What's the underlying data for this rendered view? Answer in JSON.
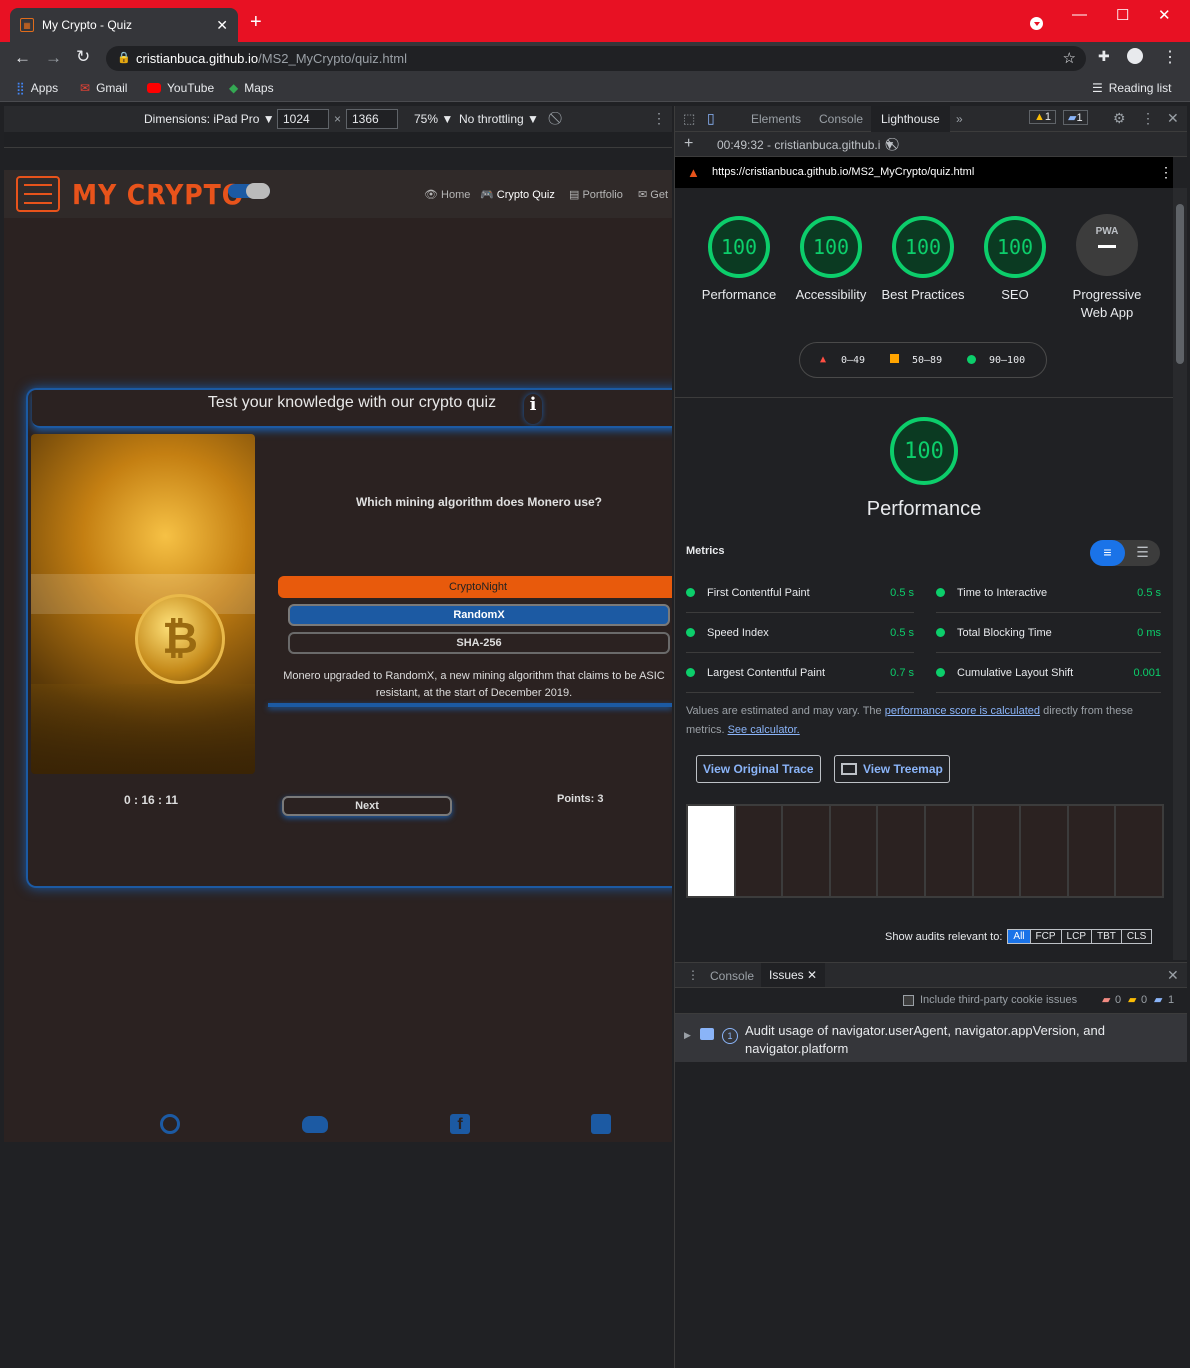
{
  "browser": {
    "tab_title": "My Crypto - Quiz",
    "new_tab": "+",
    "url_host": "cristianbuca.github.io",
    "url_path": "/MS2_MyCrypto/quiz.html",
    "bookmarks": [
      "Apps",
      "Gmail",
      "YouTube",
      "Maps"
    ],
    "reading_list": "Reading list"
  },
  "device_toolbar": {
    "dimensions_label": "Dimensions: iPad Pro ▼",
    "width": "1024",
    "times": "×",
    "height": "1366",
    "zoom": "75% ▼",
    "throttling": "No throttling ▼"
  },
  "site": {
    "logo": "MY CRYPTO",
    "nav": [
      "Home",
      "Crypto Quiz",
      "Portfolio",
      "Get"
    ],
    "quiz_title": "Test your knowledge with our crypto quiz",
    "info_icon_text": "i",
    "question": "Which mining algorithm does Monero use?",
    "options": [
      "CryptoNight",
      "RandomX",
      "SHA-256"
    ],
    "explanation": "Monero upgraded to RandomX, a new mining algorithm that claims to be ASIC resistant, at the start of December 2019.",
    "timer": "0 : 16 : 11",
    "next_label": "Next",
    "points": "Points: 3"
  },
  "devtools": {
    "tabs": [
      "Elements",
      "Console",
      "Lighthouse",
      "»"
    ],
    "warn_count": "1",
    "info_count": "1",
    "report_select": "00:49:32 - cristianbuca.github.i ▼",
    "report_url": "https://cristianbuca.github.io/MS2_MyCrypto/quiz.html",
    "categories": [
      {
        "label": "Performance",
        "score": "100"
      },
      {
        "label": "Accessibility",
        "score": "100"
      },
      {
        "label": "Best Practices",
        "score": "100"
      },
      {
        "label": "SEO",
        "score": "100"
      },
      {
        "label": "Progressive Web App",
        "score": "PWA"
      }
    ],
    "legend": [
      "0–49",
      "50–89",
      "90–100"
    ],
    "perf_score": "100",
    "perf_title": "Performance",
    "metrics_heading": "Metrics",
    "metrics": [
      {
        "name": "First Contentful Paint",
        "value": "0.5 s"
      },
      {
        "name": "Time to Interactive",
        "value": "0.5 s"
      },
      {
        "name": "Speed Index",
        "value": "0.5 s"
      },
      {
        "name": "Total Blocking Time",
        "value": "0 ms"
      },
      {
        "name": "Largest Contentful Paint",
        "value": "0.7 s"
      },
      {
        "name": "Cumulative Layout Shift",
        "value": "0.001"
      }
    ],
    "note_pre": "Values are estimated and may vary. The ",
    "note_link": "performance score is calculated",
    "note_post": " directly from these metrics. ",
    "note_link2": "See calculator.",
    "view_trace": "View Original Trace",
    "view_treemap": "View Treemap",
    "show_audits": "Show audits relevant to:",
    "filters": [
      "All",
      "FCP",
      "LCP",
      "TBT",
      "CLS"
    ],
    "drawer_tabs": [
      "Console",
      "Issues"
    ],
    "third_party": "Include third-party cookie issues",
    "issue_counts": [
      "0",
      "0",
      "1"
    ],
    "issue_count_badge": "1",
    "issue_text": "Audit usage of navigator.userAgent, navigator.appVersion, and navigator.platform"
  },
  "colors": {
    "accent_green": "#0cce6b",
    "brand_orange": "#e8531b",
    "quiz_blue": "#1c5aa3",
    "chrome_red": "#e81123"
  }
}
